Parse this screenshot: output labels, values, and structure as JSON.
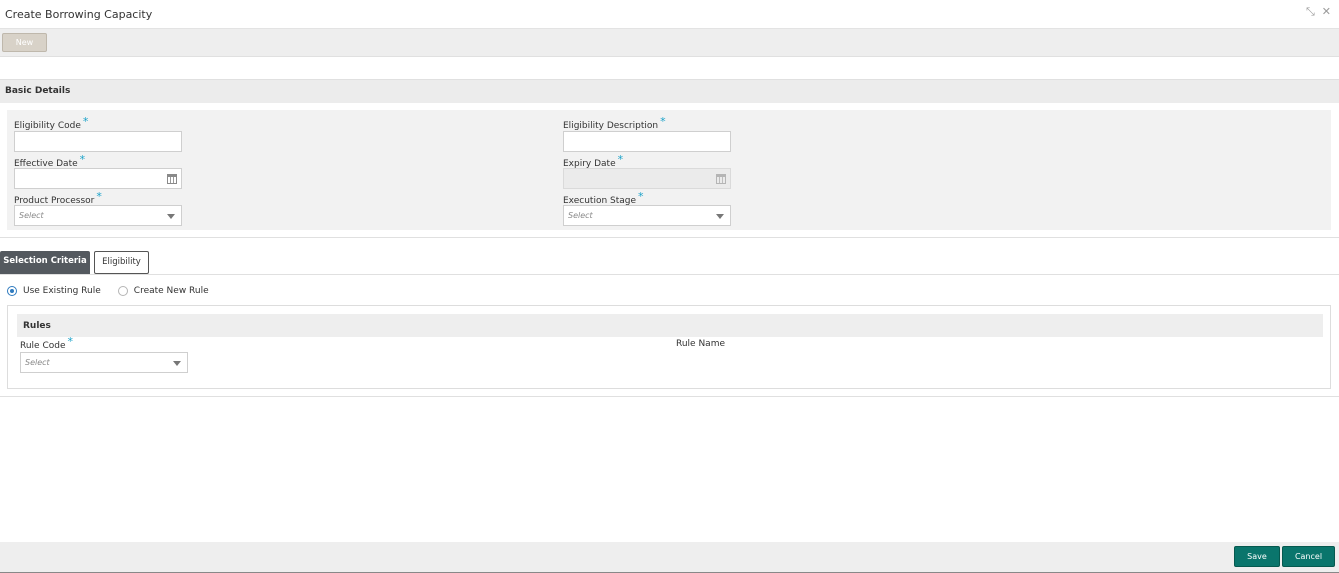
{
  "window": {
    "title": "Create Borrowing Capacity",
    "icons": [
      "minimize-icon",
      "close-icon"
    ]
  },
  "toolbar": {
    "new_label": "New"
  },
  "basic_details": {
    "section_title": "Basic Details",
    "eligibility_code": {
      "label": "Eligibility Code",
      "value": ""
    },
    "eligibility_description": {
      "label": "Eligibility Description",
      "value": ""
    },
    "effective_date": {
      "label": "Effective Date",
      "value": ""
    },
    "expiry_date": {
      "label": "Expiry Date",
      "value": "",
      "disabled": true
    },
    "product_processor": {
      "label": "Product Processor",
      "placeholder": "Select"
    },
    "execution_stage": {
      "label": "Execution Stage",
      "placeholder": "Select"
    },
    "required_marker": "*"
  },
  "tabs": [
    {
      "label": "Selection Criteria",
      "active": true
    },
    {
      "label": "Eligibility",
      "active": false
    }
  ],
  "rule_options": {
    "use_existing": {
      "label": "Use Existing Rule",
      "checked": true
    },
    "create_new": {
      "label": "Create New Rule",
      "checked": false
    }
  },
  "rules": {
    "section_title": "Rules",
    "rule_code": {
      "label": "Rule Code",
      "placeholder": "Select"
    },
    "rule_name": {
      "label": "Rule Name"
    }
  },
  "footer": {
    "save_label": "Save",
    "cancel_label": "Cancel"
  },
  "colors": {
    "accent_teal": "#0a756c",
    "active_tab": "#54595f",
    "required_star": "#1ba2c9",
    "radio_selected": "#2f7bbf"
  }
}
